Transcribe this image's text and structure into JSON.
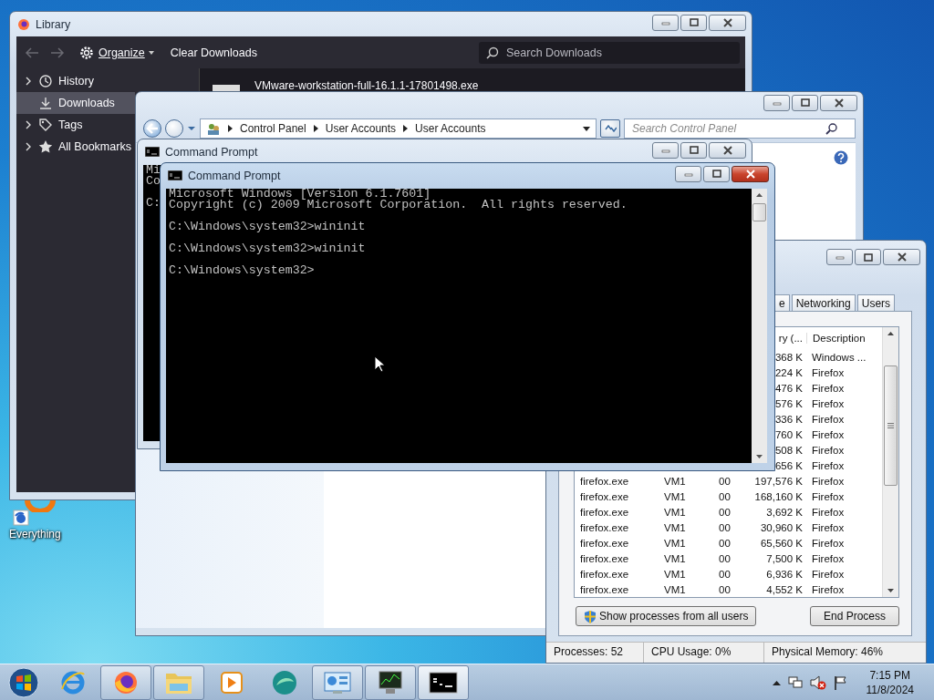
{
  "desktop": {
    "icons": [
      {
        "label": "Everything"
      }
    ]
  },
  "library": {
    "title": "Library",
    "active": false,
    "toolbar": {
      "organize": "Organize",
      "clear": "Clear Downloads",
      "search_placeholder": "Search Downloads"
    },
    "sidebar": [
      {
        "label": "History",
        "kind": "history",
        "expandable": true,
        "selected": false
      },
      {
        "label": "Downloads",
        "kind": "downloads",
        "expandable": false,
        "selected": true
      },
      {
        "label": "Tags",
        "kind": "tags",
        "expandable": true,
        "selected": false
      },
      {
        "label": "All Bookmarks",
        "kind": "bookmarks",
        "expandable": true,
        "selected": false
      }
    ],
    "downloads": [
      {
        "name": "VMware-workstation-full-16.1.1-17801498.exe"
      }
    ]
  },
  "control_panel": {
    "active": false,
    "breadcrumb": [
      "Control Panel",
      "User Accounts",
      "User Accounts"
    ],
    "search_placeholder": "Search Control Panel"
  },
  "command_prompt_back": {
    "title": "Command Prompt",
    "active": false,
    "output": "Mi\nCo\n\nC:"
  },
  "command_prompt": {
    "title": "Command Prompt",
    "active": true,
    "output": "Microsoft Windows [Version 6.1.7601]\nCopyright (c) 2009 Microsoft Corporation.  All rights reserved.\n\nC:\\Windows\\system32>wininit\n\nC:\\Windows\\system32>wininit\n\nC:\\Windows\\system32>"
  },
  "task_manager": {
    "active": false,
    "tabs": [
      {
        "label": "e",
        "selected": false
      },
      {
        "label": "Networking",
        "selected": false
      },
      {
        "label": "Users",
        "selected": false
      }
    ],
    "headers": [
      "ry (...",
      "Description"
    ],
    "rows": [
      {
        "column_4": "368 K",
        "column_5": "Windows ..."
      },
      {
        "column_4": "224 K",
        "column_5": "Firefox"
      },
      {
        "column_4": "476 K",
        "column_5": "Firefox"
      },
      {
        "column_4": "576 K",
        "column_5": "Firefox"
      },
      {
        "column_4": "336 K",
        "column_5": "Firefox"
      },
      {
        "column_4": "760 K",
        "column_5": "Firefox"
      },
      {
        "column_4": "508 K",
        "column_5": "Firefox"
      },
      {
        "column_4": "656 K",
        "column_5": "Firefox"
      },
      {
        "column_1": "firefox.exe",
        "column_2": "VM1",
        "column_3": "00",
        "column_4": "197,576 K",
        "column_5": "Firefox"
      },
      {
        "column_1": "firefox.exe",
        "column_2": "VM1",
        "column_3": "00",
        "column_4": "168,160 K",
        "column_5": "Firefox"
      },
      {
        "column_1": "firefox.exe",
        "column_2": "VM1",
        "column_3": "00",
        "column_4": "3,692 K",
        "column_5": "Firefox"
      },
      {
        "column_1": "firefox.exe",
        "column_2": "VM1",
        "column_3": "00",
        "column_4": "30,960 K",
        "column_5": "Firefox"
      },
      {
        "column_1": "firefox.exe",
        "column_2": "VM1",
        "column_3": "00",
        "column_4": "65,560 K",
        "column_5": "Firefox"
      },
      {
        "column_1": "firefox.exe",
        "column_2": "VM1",
        "column_3": "00",
        "column_4": "7,500 K",
        "column_5": "Firefox"
      },
      {
        "column_1": "firefox.exe",
        "column_2": "VM1",
        "column_3": "00",
        "column_4": "6,936 K",
        "column_5": "Firefox"
      },
      {
        "column_1": "firefox.exe",
        "column_2": "VM1",
        "column_3": "00",
        "column_4": "4,552 K",
        "column_5": "Firefox"
      }
    ],
    "buttons": [
      "Show processes from all users",
      "End Process"
    ],
    "status_bar": [
      "Processes: 52",
      "CPU Usage: 0%",
      "Physical Memory: 46%"
    ]
  },
  "taskbar": {
    "apps": [
      {
        "kind": "ie",
        "running": false,
        "active": false
      },
      {
        "kind": "firefox",
        "running": true,
        "active": false
      },
      {
        "kind": "explorer",
        "running": true,
        "active": false
      },
      {
        "kind": "media",
        "running": false,
        "active": false
      },
      {
        "kind": "sphere",
        "running": false,
        "active": false
      },
      {
        "kind": "control-panel",
        "running": true,
        "active": false
      },
      {
        "kind": "task-manager",
        "running": true,
        "active": false
      },
      {
        "kind": "console",
        "running": true,
        "active": true
      }
    ],
    "clock": {
      "time": "7:15 PM",
      "date": "11/8/2024"
    }
  }
}
